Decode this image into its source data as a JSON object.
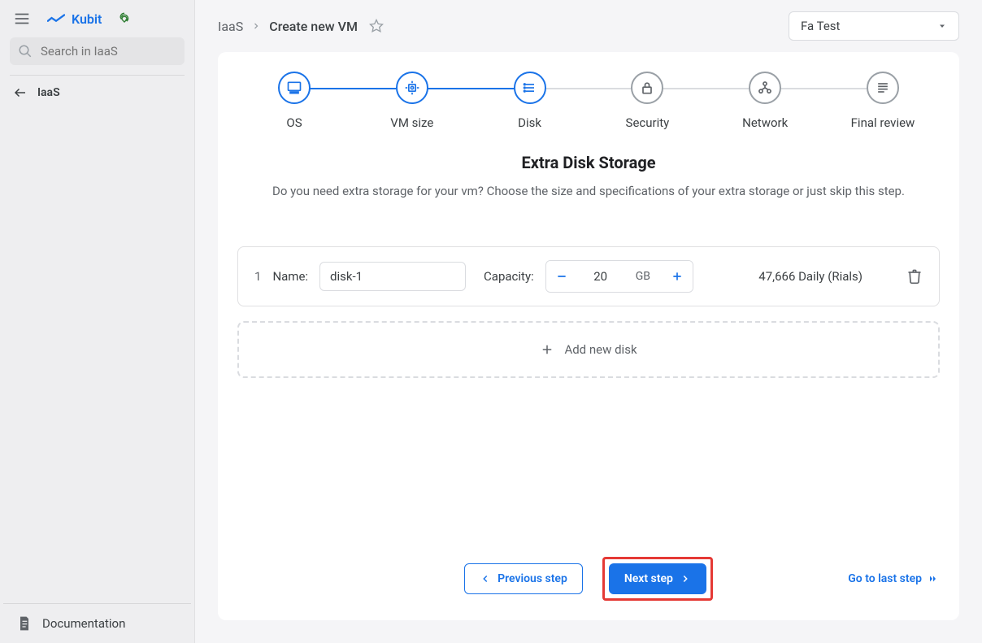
{
  "sidebar": {
    "logo": "Kubit",
    "search_placeholder": "Search in IaaS",
    "back_label": "IaaS",
    "documentation": "Documentation"
  },
  "breadcrumb": {
    "root": "IaaS",
    "current": "Create new VM"
  },
  "workspace": {
    "selected": "Fa Test"
  },
  "steps": [
    {
      "label": "OS"
    },
    {
      "label": "VM size"
    },
    {
      "label": "Disk"
    },
    {
      "label": "Security"
    },
    {
      "label": "Network"
    },
    {
      "label": "Final review"
    }
  ],
  "page": {
    "title": "Extra Disk Storage",
    "subtitle": "Do you need extra storage for your vm? Choose the size and specifications of your extra storage or just skip this step."
  },
  "disk": {
    "index": "1",
    "name_label": "Name:",
    "name_value": "disk-1",
    "capacity_label": "Capacity:",
    "capacity_value": "20",
    "capacity_unit": "GB",
    "price": "47,666 Daily (Rials)"
  },
  "add_disk_label": "Add new disk",
  "buttons": {
    "prev": "Previous step",
    "next": "Next step",
    "last": "Go to last step"
  }
}
